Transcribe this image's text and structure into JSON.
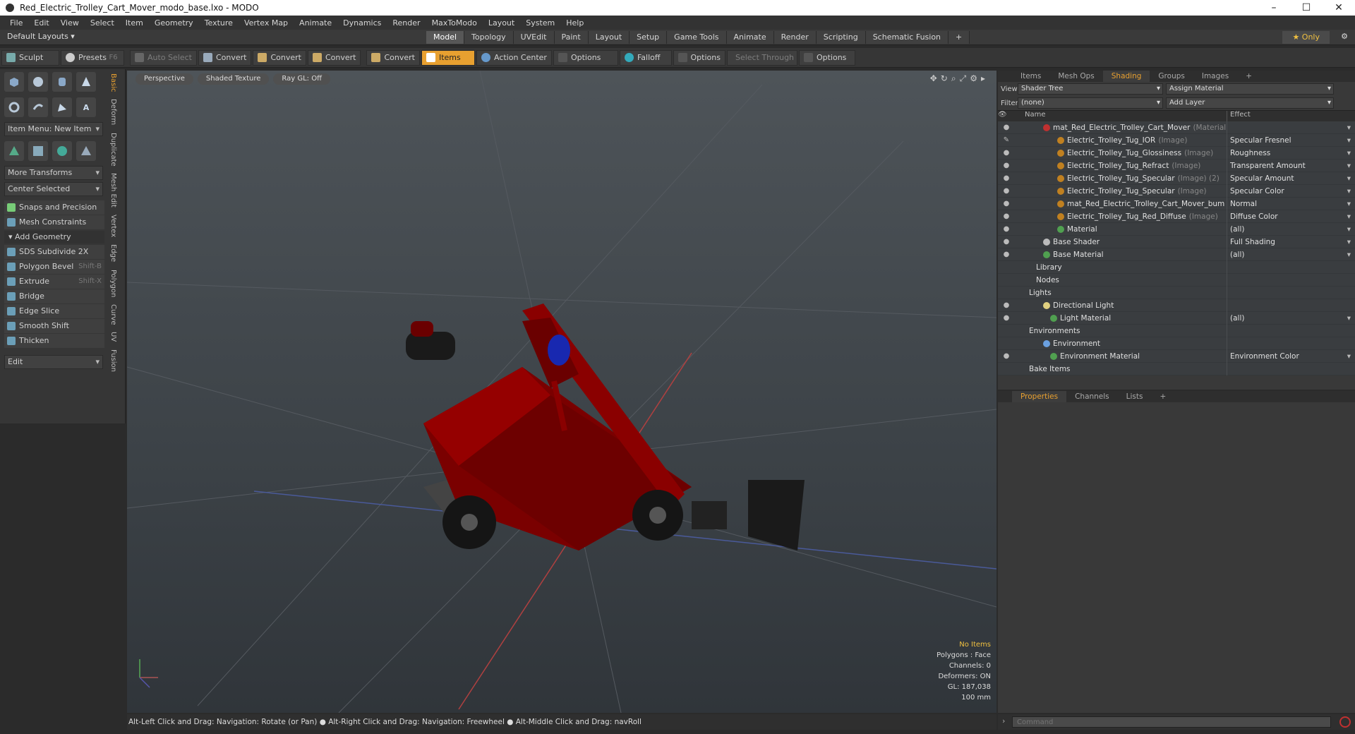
{
  "window": {
    "title": "Red_Electric_Trolley_Cart_Mover_modo_base.lxo - MODO"
  },
  "menu": [
    "File",
    "Edit",
    "View",
    "Select",
    "Item",
    "Geometry",
    "Texture",
    "Vertex Map",
    "Animate",
    "Dynamics",
    "Render",
    "MaxToModo",
    "Layout",
    "System",
    "Help"
  ],
  "layout": {
    "default_label": "Default Layouts ▾",
    "tabs": [
      "Model",
      "Topology",
      "UVEdit",
      "Paint",
      "Layout",
      "Setup",
      "Game Tools",
      "Animate",
      "Render",
      "Scripting",
      "Schematic Fusion"
    ],
    "active_tab": "Model",
    "only_label": "Only"
  },
  "toolbar": {
    "sculpt": "Sculpt",
    "presets": "Presets",
    "presets_key": "F6",
    "auto_select": "Auto Select",
    "convert": "Convert",
    "items": "Items",
    "action_center": "Action Center",
    "options": "Options",
    "falloff": "Falloff",
    "select_through": "Select Through"
  },
  "left": {
    "item_menu": "Item Menu: New Item",
    "more_transforms": "More Transforms",
    "center_selected": "Center Selected",
    "snaps": "Snaps and Precision",
    "mesh_constraints": "Mesh Constraints",
    "add_geometry": "Add Geometry",
    "tools": [
      {
        "label": "SDS Subdivide 2X",
        "key": ""
      },
      {
        "label": "Polygon Bevel",
        "key": "Shift-B"
      },
      {
        "label": "Extrude",
        "key": "Shift-X"
      },
      {
        "label": "Bridge",
        "key": ""
      },
      {
        "label": "Edge Slice",
        "key": ""
      },
      {
        "label": "Smooth Shift",
        "key": ""
      },
      {
        "label": "Thicken",
        "key": ""
      }
    ],
    "edit": "Edit",
    "vtabs": [
      "Basic",
      "Deform",
      "Duplicate",
      "Mesh Edit",
      "Vertex",
      "Edge",
      "Polygon",
      "Curve",
      "UV",
      "Fusion"
    ]
  },
  "viewport": {
    "perspective": "Perspective",
    "shading": "Shaded Texture",
    "raygl": "Ray GL: Off",
    "stats": {
      "items": "No Items",
      "polygons": "Polygons : Face",
      "channels": "Channels: 0",
      "deformers": "Deformers: ON",
      "gl": "GL: 187,038",
      "unit": "100 mm"
    }
  },
  "status": "Alt-Left Click and Drag: Navigation: Rotate (or Pan) ● Alt-Right Click and Drag: Navigation: Freewheel ● Alt-Middle Click and Drag: navRoll",
  "right": {
    "tabs": [
      "Items",
      "Mesh Ops",
      "Shading",
      "Groups",
      "Images"
    ],
    "active_tab": "Shading",
    "view_label": "View",
    "view_value": "Shader Tree",
    "assign": "Assign Material",
    "filter_label": "Filter",
    "filter_value": "(none)",
    "add_layer": "Add Layer",
    "col_name": "Name",
    "col_effect": "Effect",
    "rows": [
      {
        "name": "mat_Red_Electric_Trolley_Cart_Mover",
        "sfx": "(Material)",
        "effect": "",
        "indent": 4,
        "color": "#c03030",
        "eye": "●"
      },
      {
        "name": "Electric_Trolley_Tug_IOR",
        "sfx": "(Image)",
        "effect": "Specular Fresnel",
        "indent": 6,
        "color": "#c08020",
        "eye": "✎"
      },
      {
        "name": "Electric_Trolley_Tug_Glossiness",
        "sfx": "(Image)",
        "effect": "Roughness",
        "indent": 6,
        "color": "#c08020",
        "eye": "●"
      },
      {
        "name": "Electric_Trolley_Tug_Refract",
        "sfx": "(Image)",
        "effect": "Transparent Amount",
        "indent": 6,
        "color": "#c08020",
        "eye": "●"
      },
      {
        "name": "Electric_Trolley_Tug_Specular",
        "sfx": "(Image) (2)",
        "effect": "Specular Amount",
        "indent": 6,
        "color": "#c08020",
        "eye": "●"
      },
      {
        "name": "Electric_Trolley_Tug_Specular",
        "sfx": "(Image)",
        "effect": "Specular Color",
        "indent": 6,
        "color": "#c08020",
        "eye": "●"
      },
      {
        "name": "mat_Red_Electric_Trolley_Cart_Mover_bum ...",
        "sfx": "",
        "effect": "Normal",
        "indent": 6,
        "color": "#c08020",
        "eye": "●"
      },
      {
        "name": "Electric_Trolley_Tug_Red_Diffuse",
        "sfx": "(Image)",
        "effect": "Diffuse Color",
        "indent": 6,
        "color": "#c08020",
        "eye": "●"
      },
      {
        "name": "Material",
        "sfx": "",
        "effect": "(all)",
        "indent": 6,
        "color": "#50a050",
        "eye": "●"
      },
      {
        "name": "Base Shader",
        "sfx": "",
        "effect": "Full Shading",
        "indent": 4,
        "color": "#bbbbbb",
        "eye": "●"
      },
      {
        "name": "Base Material",
        "sfx": "",
        "effect": "(all)",
        "indent": 4,
        "color": "#50a050",
        "eye": "●"
      },
      {
        "name": "Library",
        "sfx": "",
        "effect": "",
        "indent": 3,
        "color": "",
        "eye": ""
      },
      {
        "name": "Nodes",
        "sfx": "",
        "effect": "",
        "indent": 3,
        "color": "",
        "eye": ""
      },
      {
        "name": "Lights",
        "sfx": "",
        "effect": "",
        "indent": 2,
        "color": "",
        "eye": ""
      },
      {
        "name": "Directional Light",
        "sfx": "",
        "effect": "",
        "indent": 4,
        "color": "#e0d080",
        "eye": "●"
      },
      {
        "name": "Light Material",
        "sfx": "",
        "effect": "(all)",
        "indent": 5,
        "color": "#50a050",
        "eye": "●"
      },
      {
        "name": "Environments",
        "sfx": "",
        "effect": "",
        "indent": 2,
        "color": "",
        "eye": ""
      },
      {
        "name": "Environment",
        "sfx": "",
        "effect": "",
        "indent": 4,
        "color": "#6aa0e0",
        "eye": ""
      },
      {
        "name": "Environment Material",
        "sfx": "",
        "effect": "Environment Color",
        "indent": 5,
        "color": "#50a050",
        "eye": "●"
      },
      {
        "name": "Bake Items",
        "sfx": "",
        "effect": "",
        "indent": 2,
        "color": "",
        "eye": ""
      }
    ],
    "prop_tabs": [
      "Properties",
      "Channels",
      "Lists"
    ],
    "command_placeholder": "Command"
  }
}
